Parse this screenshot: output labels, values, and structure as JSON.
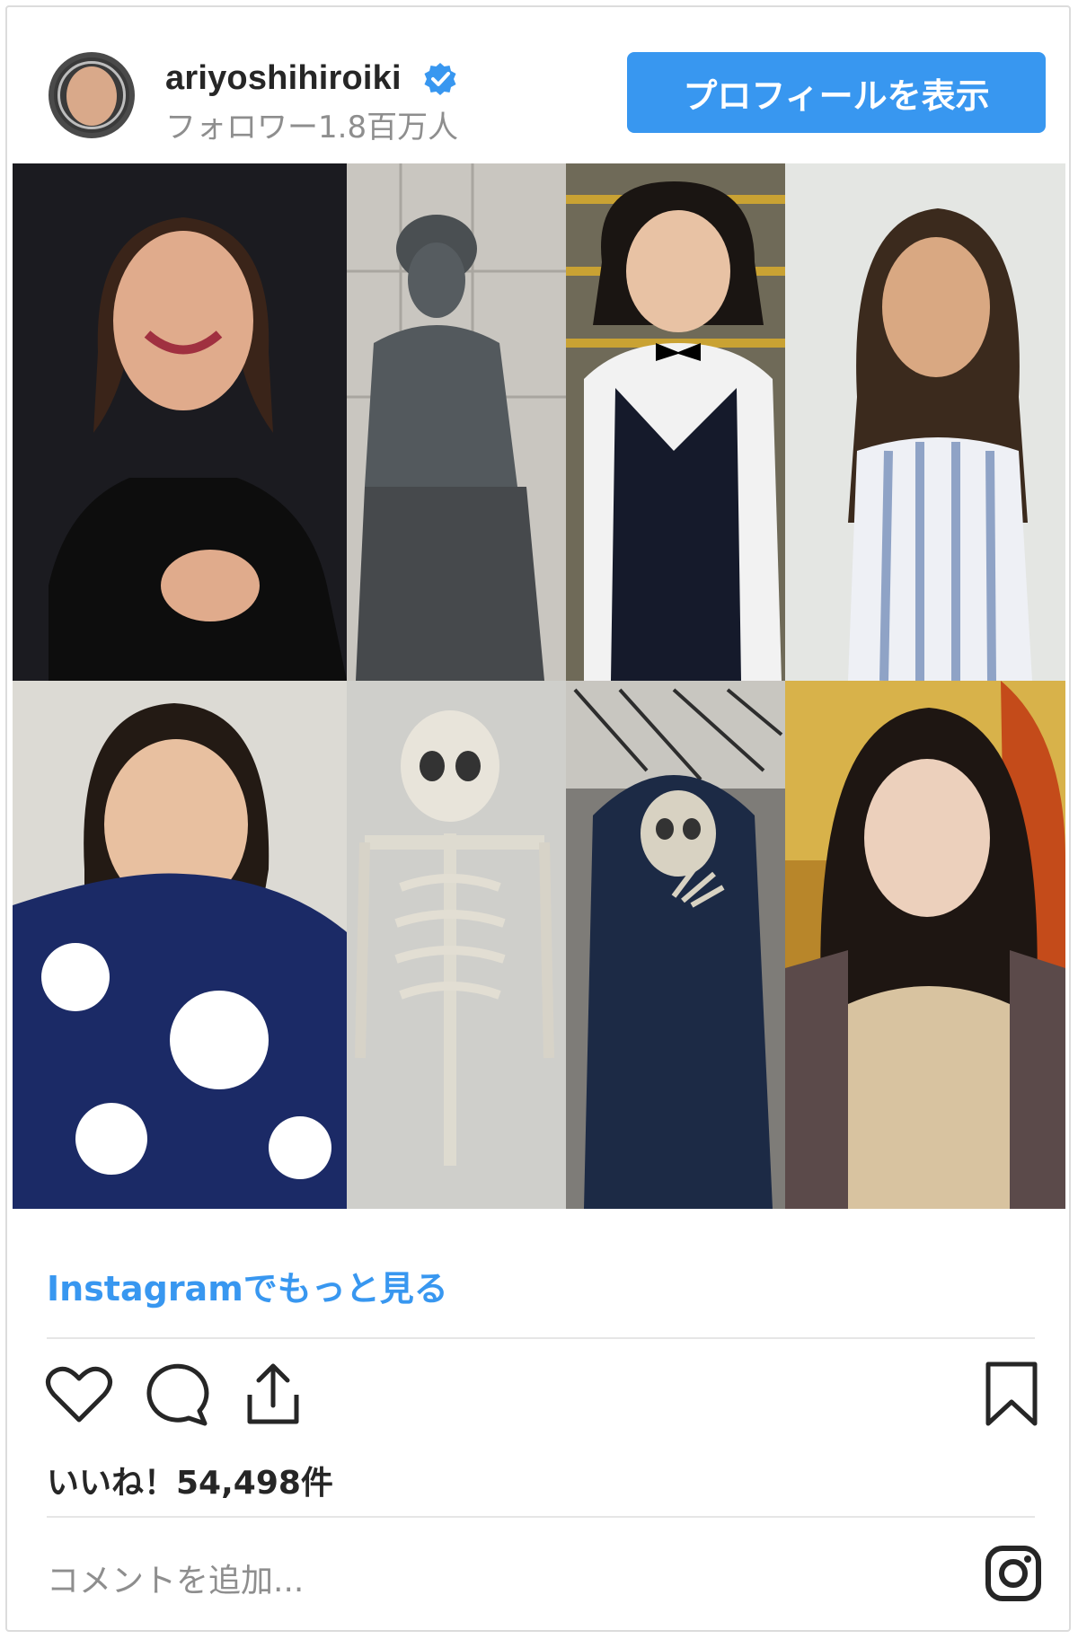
{
  "header": {
    "username": "ariyoshihiroiki",
    "followers": "フォロワー1.8百万人",
    "profile_button": "プロフィールを表示"
  },
  "post": {
    "images": [
      {
        "name": "woman-black-top",
        "icon": "photo"
      },
      {
        "name": "bronze-statue",
        "icon": "photo"
      },
      {
        "name": "man-bowtie-vest",
        "icon": "photo"
      },
      {
        "name": "woman-striped-dress",
        "icon": "photo"
      },
      {
        "name": "woman-flower-shirt",
        "icon": "photo"
      },
      {
        "name": "skeleton",
        "icon": "photo"
      },
      {
        "name": "hooded-skeleton",
        "icon": "photo"
      },
      {
        "name": "woman-long-hair",
        "icon": "photo"
      }
    ],
    "more_link": "Instagramでもっと見る",
    "likes": "いいね！54,498件",
    "comment_placeholder": "コメントを追加..."
  },
  "icons": {
    "verified": "verified-badge-icon",
    "like": "heart-icon",
    "comment": "comment-icon",
    "share": "share-icon",
    "save": "bookmark-icon",
    "instagram": "instagram-icon"
  },
  "colors": {
    "accent": "#3897f0",
    "text": "#262626",
    "muted": "#8e8e8e",
    "border": "#dcdcdc"
  }
}
